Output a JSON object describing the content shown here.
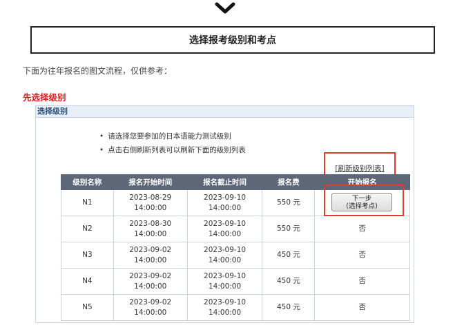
{
  "header": {
    "step_title": "选择报考级别和考点"
  },
  "intro_text": "下面为往年报名的图文流程，仅供参考：",
  "section_title": "先选择级别",
  "panel": {
    "title": "选择级别",
    "notes": [
      "请选择您要参加的日本语能力测试级别",
      "点击右侧刷新列表可以刷新下面的级别列表"
    ],
    "refresh_label": "[刷新级别列表]"
  },
  "table": {
    "headers": [
      "级别名称",
      "报名开始时间",
      "报名截止时间",
      "报名费",
      "开始报名"
    ],
    "rows": [
      {
        "level": "N1",
        "start_date": "2023-08-29",
        "start_time": "14:00:00",
        "end_date": "2023-09-10",
        "end_time": "14:00:00",
        "fee": "550 元",
        "action": "button"
      },
      {
        "level": "N2",
        "start_date": "2023-08-30",
        "start_time": "14:00:00",
        "end_date": "2023-09-10",
        "end_time": "14:00:00",
        "fee": "550 元",
        "action": "否"
      },
      {
        "level": "N3",
        "start_date": "2023-09-02",
        "start_time": "14:00:00",
        "end_date": "2023-09-10",
        "end_time": "14:00:00",
        "fee": "450 元",
        "action": "否"
      },
      {
        "level": "N4",
        "start_date": "2023-09-02",
        "start_time": "14:00:00",
        "end_date": "2023-09-10",
        "end_time": "14:00:00",
        "fee": "450 元",
        "action": "否"
      },
      {
        "level": "N5",
        "start_date": "2023-09-02",
        "start_time": "14:00:00",
        "end_date": "2023-09-10",
        "end_time": "14:00:00",
        "fee": "450 元",
        "action": "否"
      }
    ],
    "next_button": {
      "line1": "下一步",
      "line2": "(选择考点)"
    }
  },
  "colors": {
    "highlight": "#e23b2e",
    "header_bg": "#5e6777",
    "section_title": "#d22222",
    "panel_title": "#2b4f7c"
  },
  "icons": {
    "top": "chevron-down-icon"
  }
}
